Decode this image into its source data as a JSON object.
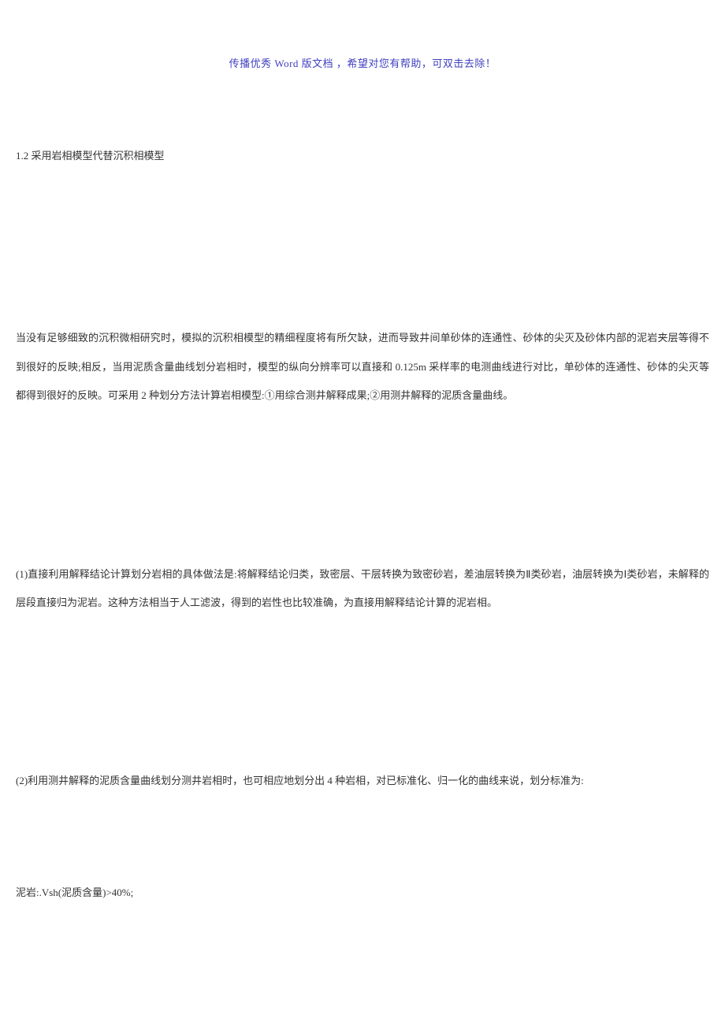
{
  "header": {
    "notice": "传播优秀 Word 版文档 ，希望对您有帮助，可双击去除！"
  },
  "section": {
    "title": "1.2 采用岩相模型代替沉积相模型"
  },
  "paragraphs": {
    "p1": "当没有足够细致的沉积微相研究时，模拟的沉积相模型的精细程度将有所欠缺，进而导致井间单砂体的连通性、砂体的尖灭及砂体内部的泥岩夹层等得不到很好的反映;相反，当用泥质含量曲线划分岩相时，模型的纵向分辨率可以直接和 0.125m 采样率的电测曲线进行对比，单砂体的连通性、砂体的尖灭等都得到很好的反映。可采用 2 种划分方法计算岩相模型:①用综合测井解释成果;②用测井解释的泥质含量曲线。",
    "p2": "(1)直接利用解释结论计算划分岩相的具体做法是:将解释结论归类，致密层、干层转换为致密砂岩，差油层转换为Ⅱ类砂岩，油层转换为Ⅰ类砂岩，未解释的层段直接归为泥岩。这种方法相当于人工滤波，得到的岩性也比较准确，为直接用解释结论计算的泥岩相。",
    "p3": "(2)利用测井解释的泥质含量曲线划分测井岩相时，也可相应地划分出 4 种岩相，对已标准化、归一化的曲线来说，划分标准为:",
    "p4": "泥岩:.Vsh(泥质含量)>40%;"
  }
}
